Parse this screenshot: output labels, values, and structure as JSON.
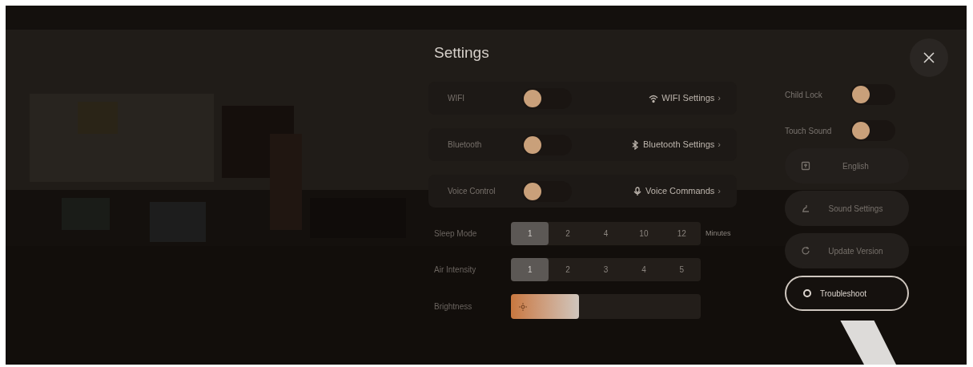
{
  "title": "Settings",
  "toggle_cards": [
    {
      "label": "WIFI",
      "on": false,
      "link": "WIFI Settings",
      "chevron": "›"
    },
    {
      "label": "Bluetooth",
      "on": false,
      "link": "Bluetooth Settings",
      "chevron": "›"
    },
    {
      "label": "Voice Control",
      "on": false,
      "link": "Voice Commands",
      "chevron": "›"
    }
  ],
  "sleep_mode": {
    "label": "Sleep Mode",
    "unit": "Minutes",
    "options": [
      {
        "label": "1",
        "selected": true
      },
      {
        "label": "2",
        "selected": false
      },
      {
        "label": "4",
        "selected": false
      },
      {
        "label": "10",
        "selected": false
      },
      {
        "label": "12",
        "selected": false
      }
    ]
  },
  "air_intensity": {
    "label": "Air Intensity",
    "options": [
      {
        "label": "1",
        "selected": true
      },
      {
        "label": "2",
        "selected": false
      },
      {
        "label": "3",
        "selected": false
      },
      {
        "label": "4",
        "selected": false
      },
      {
        "label": "5",
        "selected": false
      }
    ]
  },
  "brightness": {
    "label": "Brightness",
    "level": 0.36
  },
  "side_toggles": [
    {
      "label": "Child Lock",
      "on": false
    },
    {
      "label": "Touch Sound",
      "on": false
    }
  ],
  "side_buttons": [
    {
      "label": "English",
      "selected": false
    },
    {
      "label": "Sound Settings",
      "selected": false
    },
    {
      "label": "Update Version",
      "selected": false
    },
    {
      "label": "Troubleshoot",
      "selected": true
    }
  ]
}
